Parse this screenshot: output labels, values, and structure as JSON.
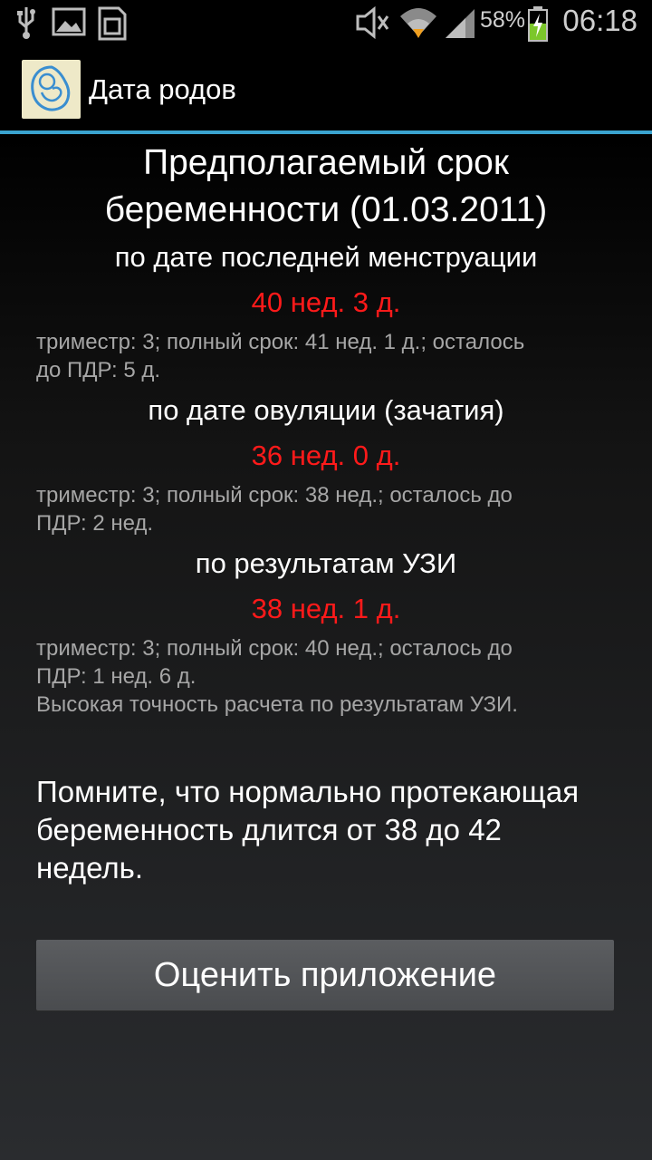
{
  "status_bar": {
    "battery_percent": "58%",
    "time": "06:18",
    "icons": [
      "usb-icon",
      "image-icon",
      "sim-icon",
      "mute-icon",
      "wifi-icon",
      "signal-icon",
      "battery-charging-icon"
    ]
  },
  "action_bar": {
    "title": "Дата родов",
    "icon": "fetus-app-icon"
  },
  "main": {
    "heading_line1": "Предполагаемый срок",
    "heading_line2": "беременности (01.03.2011)",
    "sections": [
      {
        "label": "по дате последней менструации",
        "value": "40 нед. 3 д.",
        "details": [
          "триместр: 3; полный срок: 41 нед. 1 д.; осталось",
          "до ПДР: 5 д."
        ]
      },
      {
        "label": "по дате овуляции (зачатия)",
        "value": "36 нед. 0 д.",
        "details": [
          "триместр: 3; полный срок: 38 нед.; осталось до",
          "ПДР: 2 нед."
        ]
      },
      {
        "label": "по результатам УЗИ",
        "value": "38 нед. 1 д.",
        "details": [
          "триместр: 3; полный срок: 40 нед.; осталось до",
          "ПДР: 1 нед. 6 д.",
          "Высокая точность расчета по результатам УЗИ."
        ]
      }
    ],
    "note": [
      "Помните, что нормально протекающая",
      "беременность длится от 38 до 42",
      "недель."
    ],
    "rate_button": "Оценить приложение"
  },
  "colors": {
    "accent": "#3aa3cf",
    "value_red": "#ff1a1a",
    "detail_gray": "#a6a6a6"
  }
}
